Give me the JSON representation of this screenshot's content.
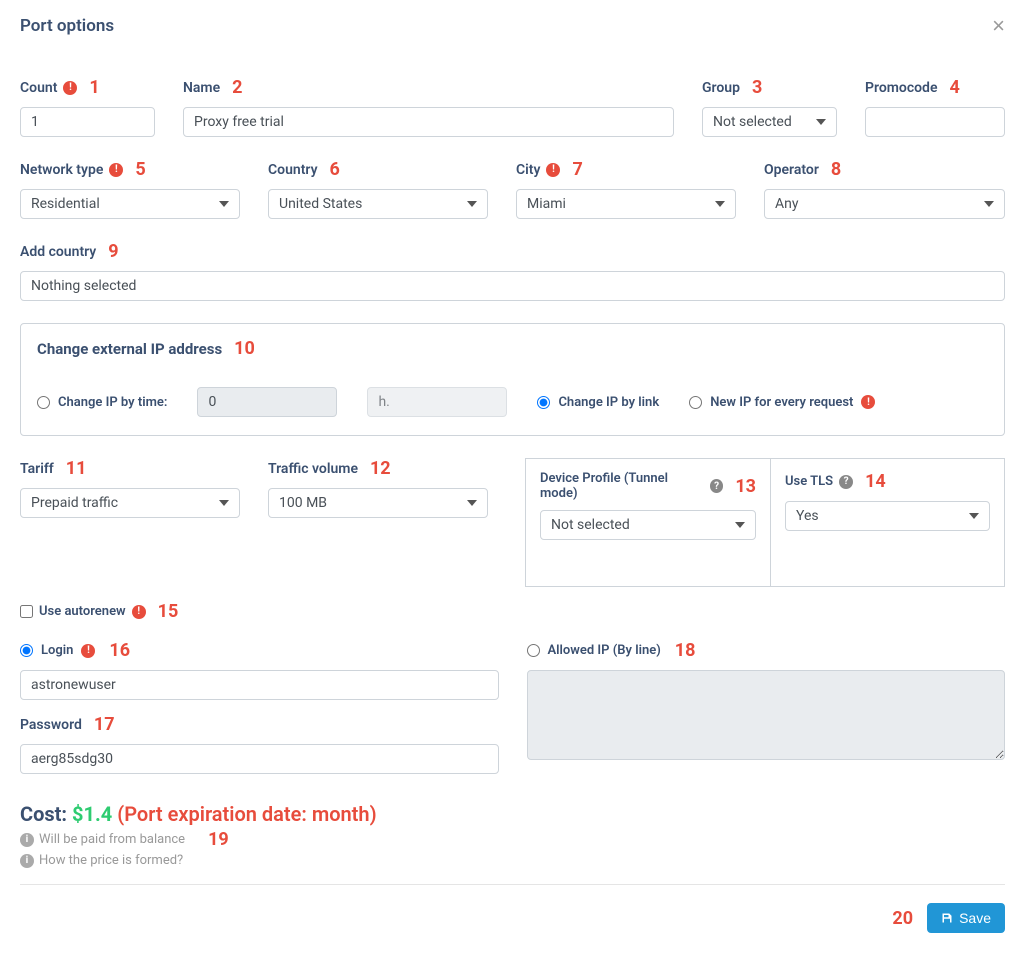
{
  "modal": {
    "title": "Port options"
  },
  "nums": {
    "count": "1",
    "name": "2",
    "group": "3",
    "promocode": "4",
    "network_type": "5",
    "country": "6",
    "city": "7",
    "operator": "8",
    "add_country": "9",
    "change_ip": "10",
    "tariff": "11",
    "traffic_volume": "12",
    "device_profile": "13",
    "use_tls": "14",
    "autorenew": "15",
    "login": "16",
    "password": "17",
    "allowed_ip": "18",
    "hints": "19",
    "save": "20"
  },
  "labels": {
    "count": "Count",
    "name": "Name",
    "group": "Group",
    "promocode": "Promocode",
    "network_type": "Network type",
    "country": "Country",
    "city": "City",
    "operator": "Operator",
    "add_country": "Add country",
    "change_ip_section": "Change external IP address",
    "change_ip_time": "Change IP by time:",
    "change_ip_link": "Change IP by link",
    "new_ip_req": "New IP for every request",
    "tariff": "Tariff",
    "traffic_volume": "Traffic volume",
    "device_profile": "Device Profile (Tunnel mode)",
    "use_tls": "Use TLS",
    "autorenew": "Use autorenew",
    "login": "Login",
    "password": "Password",
    "allowed_ip": "Allowed IP (By line)"
  },
  "values": {
    "count": "1",
    "name": "Proxy free trial",
    "group": "Not selected",
    "promocode": "",
    "network_type": "Residential",
    "country": "United States",
    "city": "Miami",
    "operator": "Any",
    "add_country": "Nothing selected",
    "ip_time_value": "0",
    "ip_time_unit": "h.",
    "tariff": "Prepaid traffic",
    "traffic_volume": "100 MB",
    "device_profile": "Not selected",
    "use_tls": "Yes",
    "login": "astronewuser",
    "password": "aerg85sdg30",
    "allowed_ip": ""
  },
  "cost": {
    "label": "Cost:",
    "amount": "$1.4",
    "expiration": "(Port expiration date: month)"
  },
  "hints": {
    "balance": "Will be paid from balance",
    "price": "How the price is formed?"
  },
  "buttons": {
    "save": "Save"
  }
}
